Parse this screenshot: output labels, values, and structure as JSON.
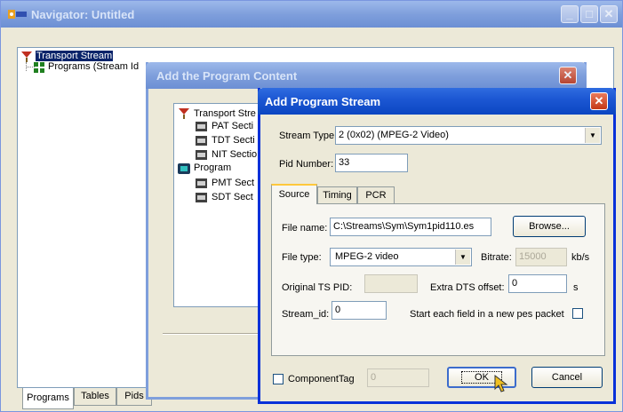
{
  "navigator": {
    "title": "Navigator: Untitled",
    "tree": [
      {
        "label": "Transport Stream",
        "icon": "transport-stream-icon"
      },
      {
        "label": "Programs (Stream Id",
        "icon": "programs-icon"
      }
    ],
    "tabs": [
      "Programs",
      "Tables",
      "Pids"
    ]
  },
  "add_program_content": {
    "title": "Add the Program Content",
    "tree": [
      {
        "label": "Transport Stre",
        "icon": "transport-stream-icon"
      },
      {
        "label": "PAT Secti",
        "icon": "section-icon"
      },
      {
        "label": "TDT Secti",
        "icon": "section-icon"
      },
      {
        "label": "NIT Sectio",
        "icon": "section-icon"
      },
      {
        "label": "Program",
        "icon": "program-icon"
      },
      {
        "label": "PMT Sect",
        "icon": "section-icon"
      },
      {
        "label": "SDT Sect",
        "icon": "section-icon"
      }
    ]
  },
  "add_program_stream": {
    "title": "Add Program Stream",
    "stream_type_label": "Stream Type",
    "stream_type_value": "2 (0x02) (MPEG-2 Video)",
    "pid_label": "Pid Number:",
    "pid_value": "33",
    "tabs": [
      "Source",
      "Timing",
      "PCR"
    ],
    "file_name_label": "File name:",
    "file_name_value": "C:\\Streams\\Sym\\Sym1pid110.es",
    "browse_label": "Browse...",
    "file_type_label": "File type:",
    "file_type_value": "MPEG-2 video",
    "bitrate_label": "Bitrate:",
    "bitrate_value": "15000",
    "bitrate_unit": "kb/s",
    "orig_pid_label": "Original TS PID:",
    "orig_pid_value": "",
    "extra_dts_label": "Extra DTS offset:",
    "extra_dts_value": "0",
    "extra_dts_unit": "s",
    "stream_id_label": "Stream_id:",
    "stream_id_value": "0",
    "new_pes_label": "Start each field in a new pes packet",
    "component_tag_label": "ComponentTag",
    "component_tag_value": "0",
    "ok_label": "OK",
    "cancel_label": "Cancel"
  }
}
